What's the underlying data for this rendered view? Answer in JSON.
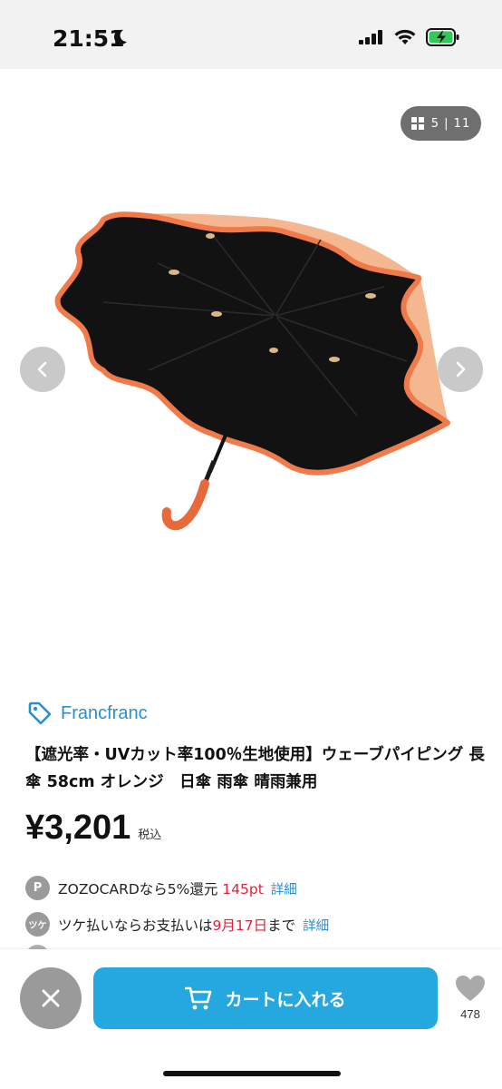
{
  "status_bar": {
    "time": "21:51"
  },
  "gallery": {
    "counter": "5 | 11",
    "icons": {
      "prev": "chevron-left-icon",
      "next": "chevron-right-icon",
      "grid": "grid-icon"
    }
  },
  "product": {
    "brand": "Francfranc",
    "title": "【遮光率・UVカット率100％生地使用】ウェーブパイピング 長傘 58cm オレンジ　日傘 雨傘 晴雨兼用",
    "price": "¥3,201",
    "tax_label": "税込"
  },
  "info_rows": [
    {
      "icon_label": "P",
      "text_before": "ZOZOCARDなら5%還元 ",
      "highlight": "145pt",
      "text_after": "",
      "link": "詳細"
    },
    {
      "icon_label": "ツケ",
      "text_before": "ツケ払いならお支払いは",
      "highlight": "9月17日",
      "text_after": "まで",
      "link": "詳細"
    }
  ],
  "bottom_bar": {
    "cart_label": "カートに入れる",
    "favorite_count": "478"
  },
  "colors": {
    "accent_blue": "#25a8e0",
    "link_blue": "#2a8fd0",
    "highlight_red": "#e0223a",
    "umbrella_trim": "#f07a4a",
    "umbrella_canopy": "#111111"
  }
}
